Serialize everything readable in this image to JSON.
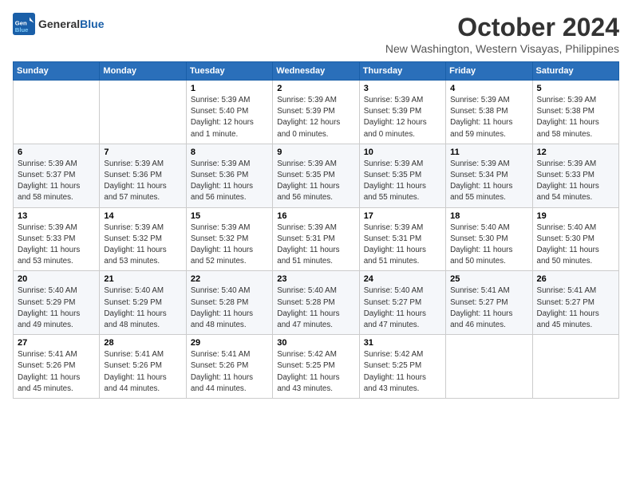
{
  "logo": {
    "text_general": "General",
    "text_blue": "Blue"
  },
  "title": "October 2024",
  "location": "New Washington, Western Visayas, Philippines",
  "weekdays": [
    "Sunday",
    "Monday",
    "Tuesday",
    "Wednesday",
    "Thursday",
    "Friday",
    "Saturday"
  ],
  "weeks": [
    [
      {
        "day": "",
        "detail": ""
      },
      {
        "day": "",
        "detail": ""
      },
      {
        "day": "1",
        "detail": "Sunrise: 5:39 AM\nSunset: 5:40 PM\nDaylight: 12 hours\nand 1 minute."
      },
      {
        "day": "2",
        "detail": "Sunrise: 5:39 AM\nSunset: 5:39 PM\nDaylight: 12 hours\nand 0 minutes."
      },
      {
        "day": "3",
        "detail": "Sunrise: 5:39 AM\nSunset: 5:39 PM\nDaylight: 12 hours\nand 0 minutes."
      },
      {
        "day": "4",
        "detail": "Sunrise: 5:39 AM\nSunset: 5:38 PM\nDaylight: 11 hours\nand 59 minutes."
      },
      {
        "day": "5",
        "detail": "Sunrise: 5:39 AM\nSunset: 5:38 PM\nDaylight: 11 hours\nand 58 minutes."
      }
    ],
    [
      {
        "day": "6",
        "detail": "Sunrise: 5:39 AM\nSunset: 5:37 PM\nDaylight: 11 hours\nand 58 minutes."
      },
      {
        "day": "7",
        "detail": "Sunrise: 5:39 AM\nSunset: 5:36 PM\nDaylight: 11 hours\nand 57 minutes."
      },
      {
        "day": "8",
        "detail": "Sunrise: 5:39 AM\nSunset: 5:36 PM\nDaylight: 11 hours\nand 56 minutes."
      },
      {
        "day": "9",
        "detail": "Sunrise: 5:39 AM\nSunset: 5:35 PM\nDaylight: 11 hours\nand 56 minutes."
      },
      {
        "day": "10",
        "detail": "Sunrise: 5:39 AM\nSunset: 5:35 PM\nDaylight: 11 hours\nand 55 minutes."
      },
      {
        "day": "11",
        "detail": "Sunrise: 5:39 AM\nSunset: 5:34 PM\nDaylight: 11 hours\nand 55 minutes."
      },
      {
        "day": "12",
        "detail": "Sunrise: 5:39 AM\nSunset: 5:33 PM\nDaylight: 11 hours\nand 54 minutes."
      }
    ],
    [
      {
        "day": "13",
        "detail": "Sunrise: 5:39 AM\nSunset: 5:33 PM\nDaylight: 11 hours\nand 53 minutes."
      },
      {
        "day": "14",
        "detail": "Sunrise: 5:39 AM\nSunset: 5:32 PM\nDaylight: 11 hours\nand 53 minutes."
      },
      {
        "day": "15",
        "detail": "Sunrise: 5:39 AM\nSunset: 5:32 PM\nDaylight: 11 hours\nand 52 minutes."
      },
      {
        "day": "16",
        "detail": "Sunrise: 5:39 AM\nSunset: 5:31 PM\nDaylight: 11 hours\nand 51 minutes."
      },
      {
        "day": "17",
        "detail": "Sunrise: 5:39 AM\nSunset: 5:31 PM\nDaylight: 11 hours\nand 51 minutes."
      },
      {
        "day": "18",
        "detail": "Sunrise: 5:40 AM\nSunset: 5:30 PM\nDaylight: 11 hours\nand 50 minutes."
      },
      {
        "day": "19",
        "detail": "Sunrise: 5:40 AM\nSunset: 5:30 PM\nDaylight: 11 hours\nand 50 minutes."
      }
    ],
    [
      {
        "day": "20",
        "detail": "Sunrise: 5:40 AM\nSunset: 5:29 PM\nDaylight: 11 hours\nand 49 minutes."
      },
      {
        "day": "21",
        "detail": "Sunrise: 5:40 AM\nSunset: 5:29 PM\nDaylight: 11 hours\nand 48 minutes."
      },
      {
        "day": "22",
        "detail": "Sunrise: 5:40 AM\nSunset: 5:28 PM\nDaylight: 11 hours\nand 48 minutes."
      },
      {
        "day": "23",
        "detail": "Sunrise: 5:40 AM\nSunset: 5:28 PM\nDaylight: 11 hours\nand 47 minutes."
      },
      {
        "day": "24",
        "detail": "Sunrise: 5:40 AM\nSunset: 5:27 PM\nDaylight: 11 hours\nand 47 minutes."
      },
      {
        "day": "25",
        "detail": "Sunrise: 5:41 AM\nSunset: 5:27 PM\nDaylight: 11 hours\nand 46 minutes."
      },
      {
        "day": "26",
        "detail": "Sunrise: 5:41 AM\nSunset: 5:27 PM\nDaylight: 11 hours\nand 45 minutes."
      }
    ],
    [
      {
        "day": "27",
        "detail": "Sunrise: 5:41 AM\nSunset: 5:26 PM\nDaylight: 11 hours\nand 45 minutes."
      },
      {
        "day": "28",
        "detail": "Sunrise: 5:41 AM\nSunset: 5:26 PM\nDaylight: 11 hours\nand 44 minutes."
      },
      {
        "day": "29",
        "detail": "Sunrise: 5:41 AM\nSunset: 5:26 PM\nDaylight: 11 hours\nand 44 minutes."
      },
      {
        "day": "30",
        "detail": "Sunrise: 5:42 AM\nSunset: 5:25 PM\nDaylight: 11 hours\nand 43 minutes."
      },
      {
        "day": "31",
        "detail": "Sunrise: 5:42 AM\nSunset: 5:25 PM\nDaylight: 11 hours\nand 43 minutes."
      },
      {
        "day": "",
        "detail": ""
      },
      {
        "day": "",
        "detail": ""
      }
    ]
  ]
}
